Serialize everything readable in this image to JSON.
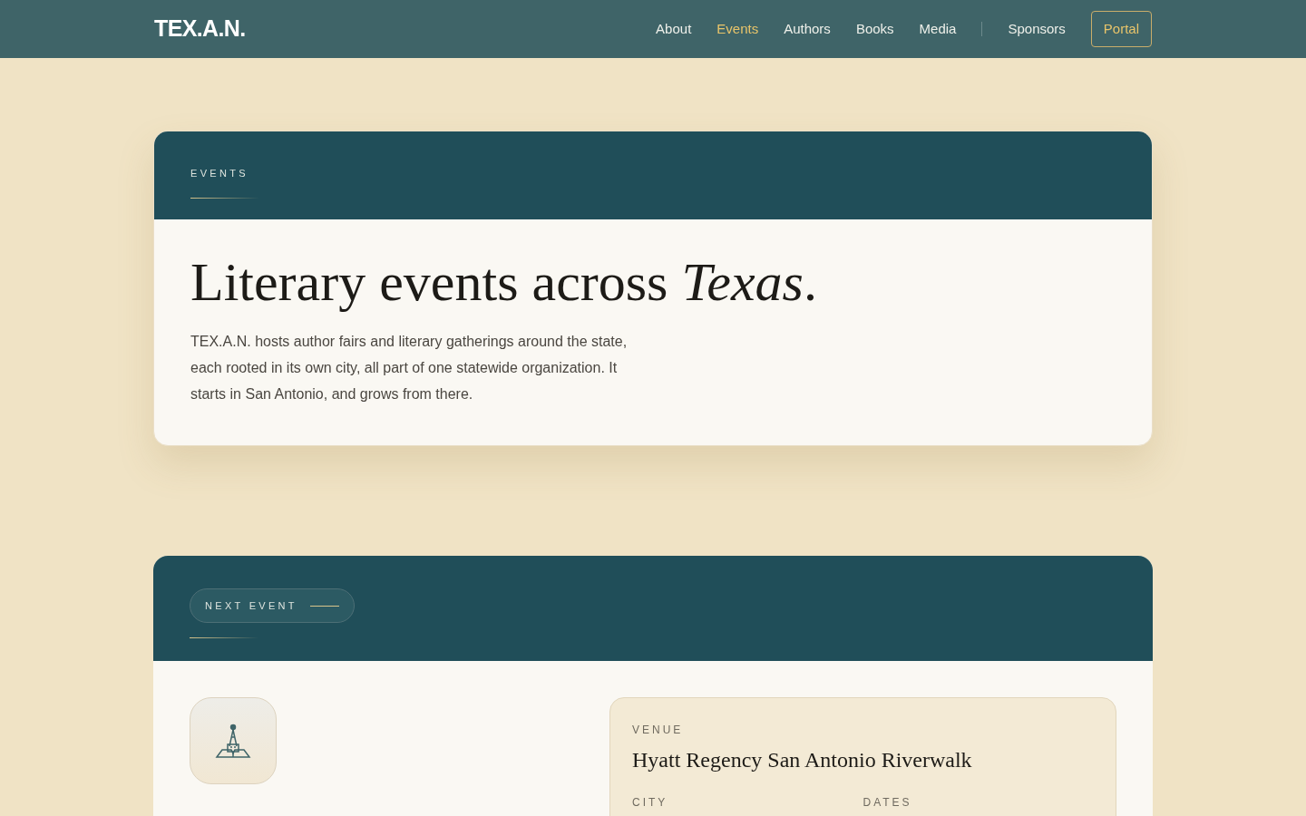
{
  "nav": {
    "brand": "TEX.A.N.",
    "links": [
      {
        "label": "About",
        "selected": false
      },
      {
        "label": "Events",
        "selected": true
      },
      {
        "label": "Authors",
        "selected": false
      },
      {
        "label": "Books",
        "selected": false
      },
      {
        "label": "Media",
        "selected": false
      }
    ],
    "secondary_link": "Sponsors",
    "cta": "Portal"
  },
  "intro": {
    "eyebrow": "EVENTS",
    "heading": "Literary events across *Texas*.",
    "text": "TEX.A.N. hosts author fairs and literary gatherings around the state, each rooted in its own city, all part of one statewide organization. It starts in San Antonio, and grows from there."
  },
  "next_event": {
    "badge": "NEXT EVENT",
    "details": [
      {
        "label": "VENUE",
        "value": "Hyatt Regency San Antonio Riverwalk"
      },
      {
        "label": "CITY"
      },
      {
        "label": "DATES"
      }
    ]
  }
}
